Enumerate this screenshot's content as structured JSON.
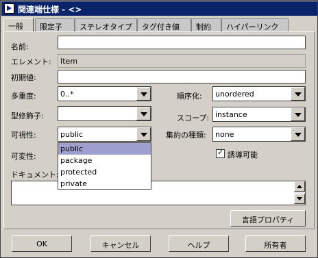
{
  "window": {
    "title": "関連端仕様 - <>"
  },
  "tabs": [
    "一般",
    "限定子",
    "ステレオタイプ",
    "タグ付き値",
    "制約",
    "ハイパーリンク"
  ],
  "form": {
    "name_label": "名前:",
    "name_value": "",
    "element_label": "エレメント:",
    "element_value": "Item",
    "initial_label": "初期値:",
    "initial_value": "",
    "multiplicity_label": "多重度:",
    "multiplicity_value": "0..*",
    "ordering_label": "順序化:",
    "ordering_value": "unordered",
    "modifier_label": "型修飾子:",
    "modifier_value": "",
    "scope_label": "スコープ:",
    "scope_value": "instance",
    "visibility_label": "可視性:",
    "visibility_value": "public",
    "aggregation_label": "集約の種類:",
    "aggregation_value": "none",
    "changeability_label": "可変性:",
    "navigable_label": "誘導可能",
    "navigable_checked": true,
    "documentation_label": "ドキュメント:",
    "documentation_value": "",
    "language_button": "言語プロパティ"
  },
  "visibility_options": [
    "public",
    "package",
    "protected",
    "private"
  ],
  "buttons": {
    "ok": "OK",
    "cancel": "キャンセル",
    "help": "ヘルプ",
    "owner": "所有者"
  },
  "colors": {
    "titlebar": "#0a246a",
    "selection": "#9fa0d0"
  }
}
